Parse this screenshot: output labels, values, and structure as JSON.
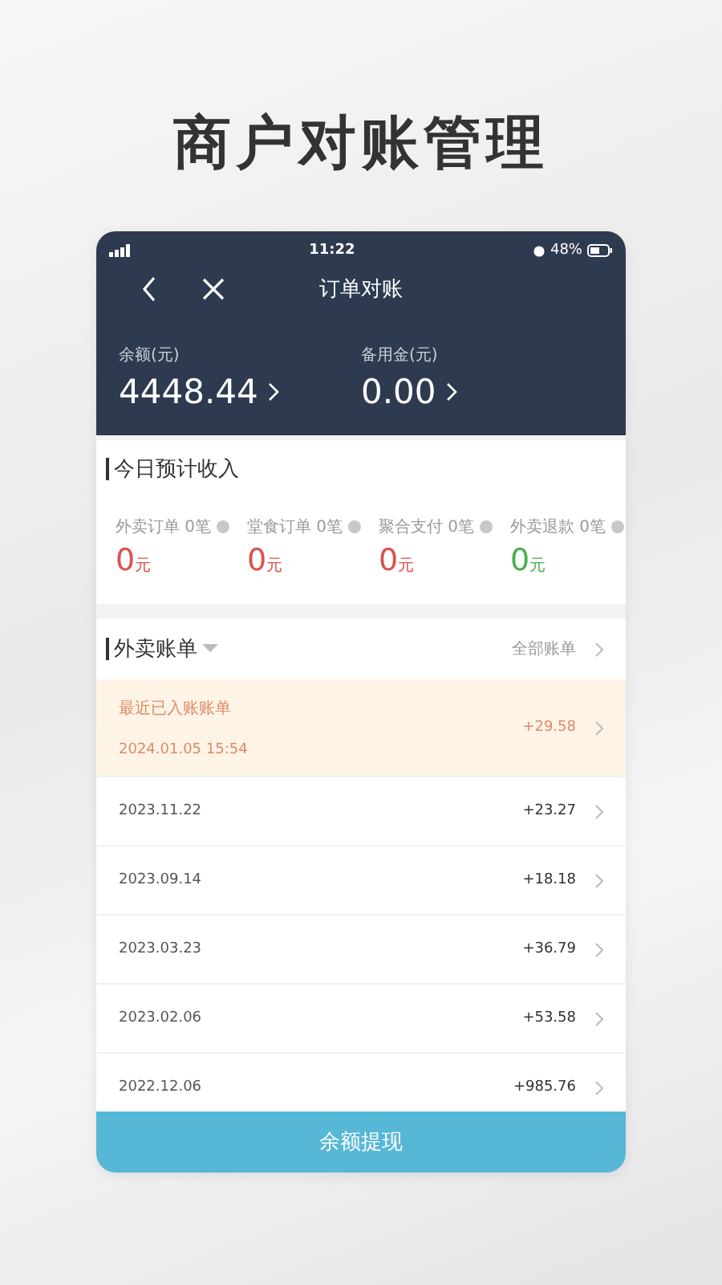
{
  "headline": "商户对账管理",
  "status_bar": {
    "time": "11:22",
    "battery": "48%"
  },
  "nav": {
    "title": "订单对账"
  },
  "balances": [
    {
      "label": "余额(元)",
      "value": "4448.44"
    },
    {
      "label": "备用金(元)",
      "value": "0.00"
    }
  ],
  "today_income": {
    "title": "今日预计收入",
    "items": [
      {
        "label": "外卖订单",
        "count": "0笔",
        "amount": "0",
        "unit": "元",
        "color": "#d9534f"
      },
      {
        "label": "堂食订单",
        "count": "0笔",
        "amount": "0",
        "unit": "元",
        "color": "#d9534f"
      },
      {
        "label": "聚合支付",
        "count": "0笔",
        "amount": "0",
        "unit": "元",
        "color": "#d9534f"
      },
      {
        "label": "外卖退款",
        "count": "0笔",
        "amount": "0",
        "unit": "元",
        "color": "#4caf50"
      }
    ]
  },
  "bills": {
    "title": "外卖账单",
    "all_link": "全部账单",
    "rows": [
      {
        "kind": "recent",
        "label": "最近已入账账单",
        "date": "2024.01.05 15:54",
        "amount": "+29.58"
      },
      {
        "kind": "plain",
        "date": "2023.11.22",
        "amount": "+23.27"
      },
      {
        "kind": "plain",
        "date": "2023.09.14",
        "amount": "+18.18"
      },
      {
        "kind": "plain",
        "date": "2023.03.23",
        "amount": "+36.79"
      },
      {
        "kind": "plain",
        "date": "2023.02.06",
        "amount": "+53.58"
      },
      {
        "kind": "plain",
        "date": "2022.12.06",
        "amount": "+985.76"
      }
    ]
  },
  "withdraw_button": "余额提现"
}
